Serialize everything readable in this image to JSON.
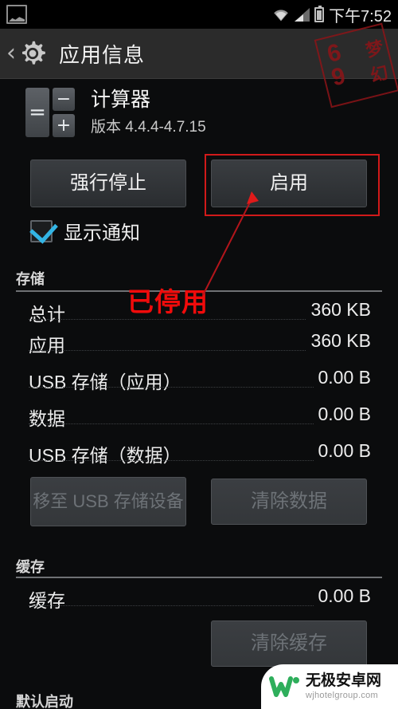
{
  "statusbar": {
    "icons": [
      "screenshot-image-icon",
      "wifi-icon",
      "signal-icon",
      "battery-icon"
    ],
    "time": "下午7:52"
  },
  "actionbar": {
    "back_label": "‹",
    "icon": "gear-icon",
    "title": "应用信息"
  },
  "stamp": {
    "c1": "6",
    "c2": "9",
    "c3": "梦",
    "c4": "幻"
  },
  "app": {
    "icon_keys": {
      "minus": "−",
      "plus": "+",
      "equals": "="
    },
    "name": "计算器",
    "version": "版本 4.4.4-4.7.15"
  },
  "buttons": {
    "force_stop": "强行停止",
    "enable": "启用",
    "move_to_usb": "移至 USB 存储设备",
    "clear_data": "清除数据",
    "clear_cache": "清除缓存"
  },
  "notifications": {
    "label": "显示通知",
    "checked": true
  },
  "sections": {
    "storage": {
      "title": "存储",
      "rows": [
        {
          "label": "总计",
          "value": "360 KB"
        },
        {
          "label": "应用",
          "value": "360 KB"
        },
        {
          "label": "USB 存储（应用）",
          "value": "0.00 B"
        },
        {
          "label": "数据",
          "value": "0.00 B"
        },
        {
          "label": "USB 存储（数据）",
          "value": "0.00 B"
        }
      ]
    },
    "cache": {
      "title": "缓存",
      "rows": [
        {
          "label": "缓存",
          "value": "0.00 B"
        }
      ]
    },
    "launch_by_default": {
      "title": "默认启动"
    }
  },
  "annotations": {
    "disabled_text": "已停用",
    "highlight_color": "#d11a1a",
    "text_color": "#f00b0b"
  },
  "watermark": {
    "title": "无极安卓网",
    "url": "wjhotelgroup.com",
    "logo_color": "#2eae5b"
  }
}
